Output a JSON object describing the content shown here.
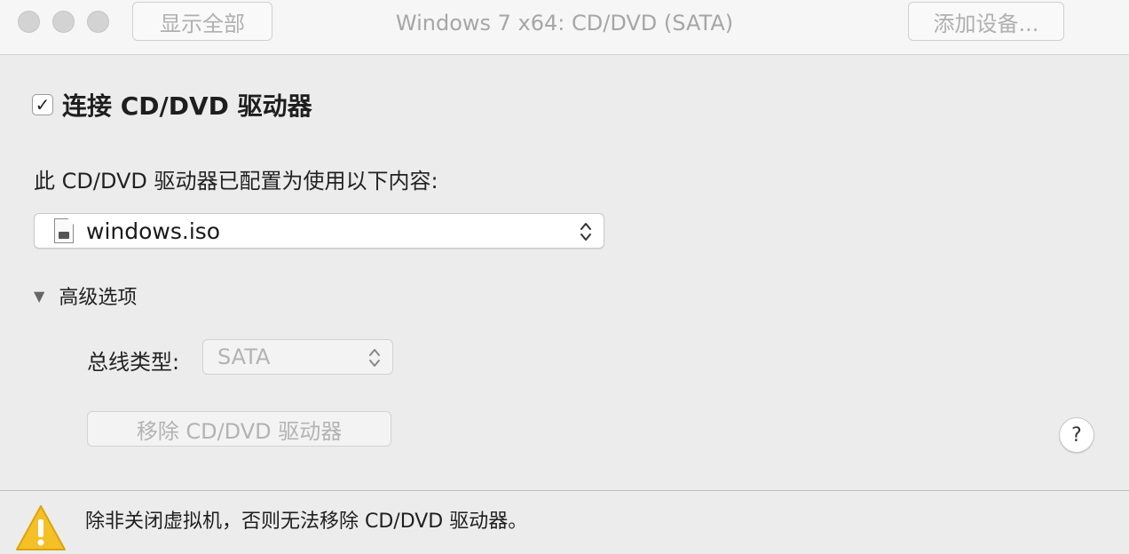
{
  "titlebar": {
    "show_all_label": "显示全部",
    "window_title": "Windows 7 x64: CD/DVD (SATA)",
    "add_device_label": "添加设备..."
  },
  "main": {
    "connect_checkbox": {
      "label": "连接 CD/DVD 驱动器",
      "checked": true,
      "check_glyph": "✓"
    },
    "config_label": "此 CD/DVD 驱动器已配置为使用以下内容:",
    "iso_select": {
      "value": "windows.iso",
      "icon": "disk-image-file-icon"
    },
    "advanced": {
      "label": "高级选项",
      "expanded": true,
      "disclosure_glyph": "▼"
    },
    "bus_type": {
      "label": "总线类型:",
      "value": "SATA"
    },
    "remove_button_label": "移除 CD/DVD 驱动器",
    "help_glyph": "?"
  },
  "footer": {
    "warning_text": "除非关闭虚拟机，否则无法移除 CD/DVD 驱动器。",
    "icon": "warning-icon",
    "warning_color": "#f5c026"
  }
}
